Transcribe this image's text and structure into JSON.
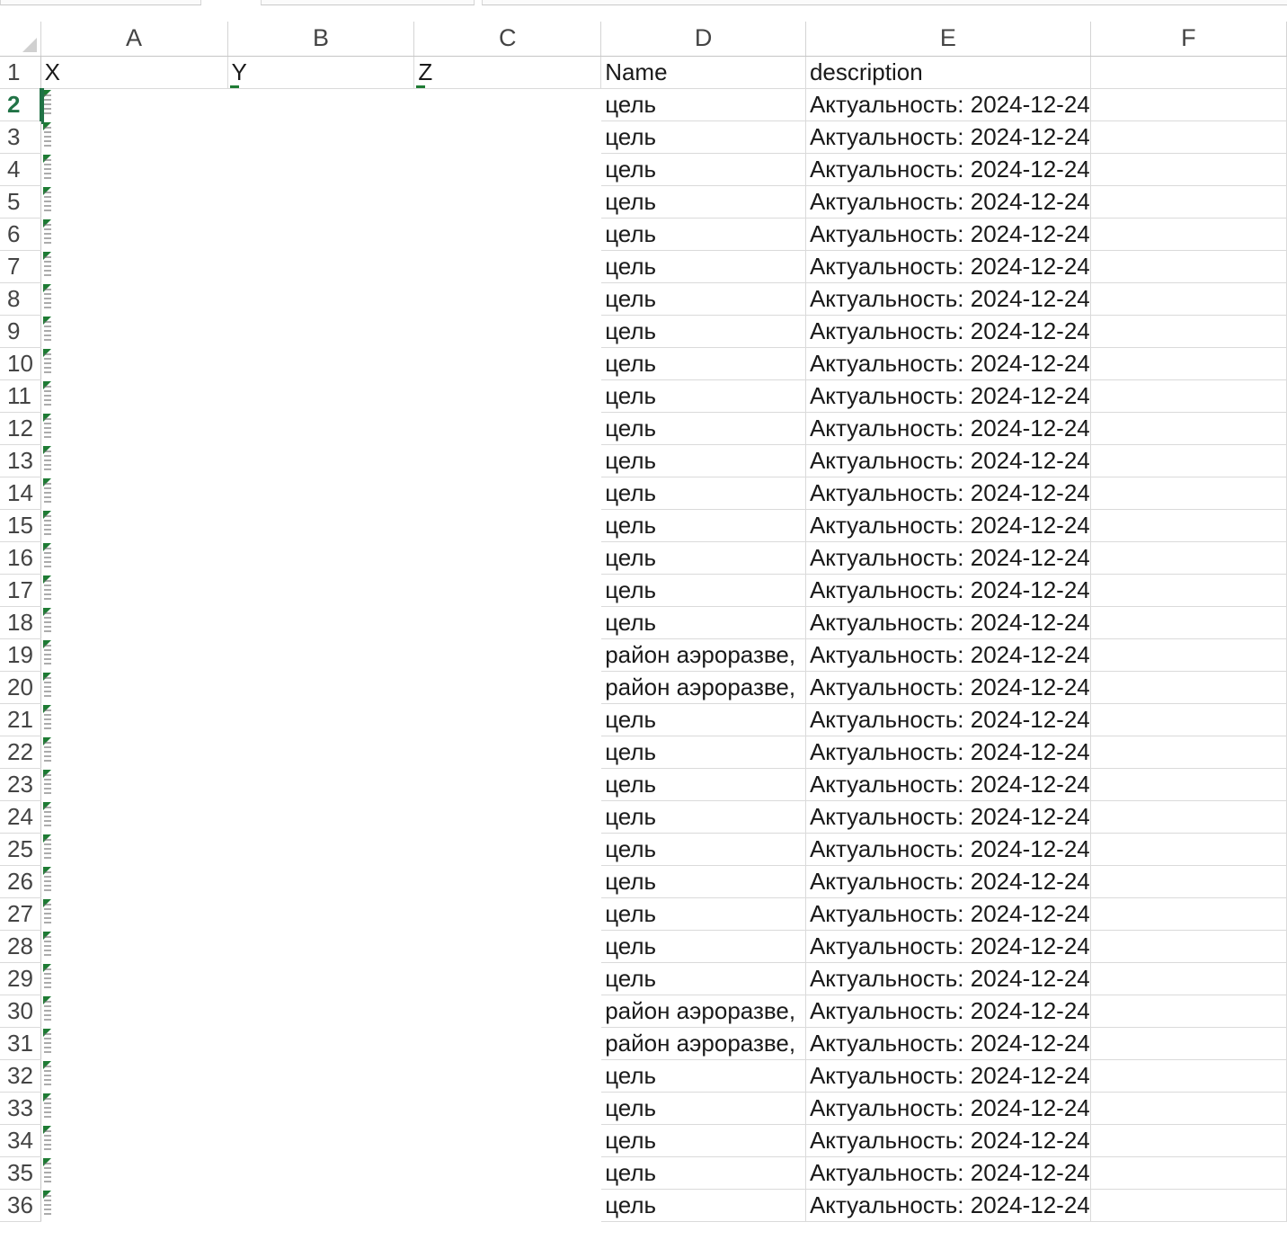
{
  "columns": [
    "A",
    "B",
    "C",
    "D",
    "E",
    "F"
  ],
  "header_row": {
    "num": "1",
    "X": "X",
    "Y": "Y",
    "Z": "Z",
    "Name": "Name",
    "description": "description"
  },
  "active_row": "2",
  "rows": [
    {
      "num": "2",
      "name": "цель",
      "desc": "Актуальность: 2024-12-24"
    },
    {
      "num": "3",
      "name": "цель",
      "desc": "Актуальность: 2024-12-24"
    },
    {
      "num": "4",
      "name": "цель",
      "desc": "Актуальность: 2024-12-24"
    },
    {
      "num": "5",
      "name": "цель",
      "desc": "Актуальность: 2024-12-24"
    },
    {
      "num": "6",
      "name": "цель",
      "desc": "Актуальность: 2024-12-24"
    },
    {
      "num": "7",
      "name": "цель",
      "desc": "Актуальность: 2024-12-24"
    },
    {
      "num": "8",
      "name": "цель",
      "desc": "Актуальность: 2024-12-24"
    },
    {
      "num": "9",
      "name": "цель",
      "desc": "Актуальность: 2024-12-24"
    },
    {
      "num": "10",
      "name": "цель",
      "desc": "Актуальность: 2024-12-24"
    },
    {
      "num": "11",
      "name": "цель",
      "desc": "Актуальность: 2024-12-24"
    },
    {
      "num": "12",
      "name": "цель",
      "desc": "Актуальность: 2024-12-24"
    },
    {
      "num": "13",
      "name": "цель",
      "desc": "Актуальность: 2024-12-24"
    },
    {
      "num": "14",
      "name": "цель",
      "desc": "Актуальность: 2024-12-24"
    },
    {
      "num": "15",
      "name": "цель",
      "desc": "Актуальность: 2024-12-24"
    },
    {
      "num": "16",
      "name": "цель",
      "desc": "Актуальность: 2024-12-24"
    },
    {
      "num": "17",
      "name": "цель",
      "desc": "Актуальность: 2024-12-24"
    },
    {
      "num": "18",
      "name": "цель",
      "desc": "Актуальность: 2024-12-24"
    },
    {
      "num": "19",
      "name": "район аэроразве,",
      "desc": "Актуальность: 2024-12-24"
    },
    {
      "num": "20",
      "name": "район аэроразве,",
      "desc": "Актуальность: 2024-12-24"
    },
    {
      "num": "21",
      "name": "цель",
      "desc": "Актуальность: 2024-12-24"
    },
    {
      "num": "22",
      "name": "цель",
      "desc": "Актуальность: 2024-12-24"
    },
    {
      "num": "23",
      "name": "цель",
      "desc": "Актуальность: 2024-12-24"
    },
    {
      "num": "24",
      "name": "цель",
      "desc": "Актуальность: 2024-12-24"
    },
    {
      "num": "25",
      "name": "цель",
      "desc": "Актуальность: 2024-12-24"
    },
    {
      "num": "26",
      "name": "цель",
      "desc": "Актуальность: 2024-12-24"
    },
    {
      "num": "27",
      "name": "цель",
      "desc": "Актуальность: 2024-12-24"
    },
    {
      "num": "28",
      "name": "цель",
      "desc": "Актуальность: 2024-12-24"
    },
    {
      "num": "29",
      "name": "цель",
      "desc": "Актуальность: 2024-12-24"
    },
    {
      "num": "30",
      "name": "район аэроразве,",
      "desc": "Актуальность: 2024-12-24"
    },
    {
      "num": "31",
      "name": "район аэроразве,",
      "desc": "Актуальность: 2024-12-24"
    },
    {
      "num": "32",
      "name": "цель",
      "desc": "Актуальность: 2024-12-24"
    },
    {
      "num": "33",
      "name": "цель",
      "desc": "Актуальность: 2024-12-24"
    },
    {
      "num": "34",
      "name": "цель",
      "desc": "Актуальность: 2024-12-24"
    },
    {
      "num": "35",
      "name": "цель",
      "desc": "Актуальность: 2024-12-24"
    },
    {
      "num": "36",
      "name": "цель",
      "desc": "Актуальность: 2024-12-24"
    }
  ],
  "colors": {
    "accent_green": "#217346",
    "error_flag": "#1e7b34",
    "gridline": "#dadada"
  }
}
